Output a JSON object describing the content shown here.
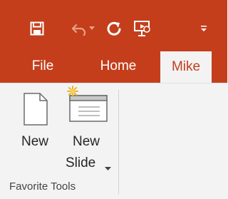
{
  "quick_access": {
    "save_icon": "save-icon",
    "undo_icon": "undo-icon",
    "redo_icon": "repeat-icon",
    "present_icon": "present-from-beginning-icon",
    "customize_icon": "customize-qat-icon"
  },
  "tabs": [
    {
      "label": "File",
      "active": false
    },
    {
      "label": "Home",
      "active": false
    },
    {
      "label": "Mike",
      "active": true
    }
  ],
  "ribbon": {
    "buttons": [
      {
        "label": "New",
        "icon": "blank-document-icon"
      },
      {
        "label_line1": "New",
        "label_line2": "Slide",
        "icon": "new-slide-icon",
        "has_dropdown": true
      }
    ],
    "group_label": "Favorite Tools"
  },
  "colors": {
    "accent": "#c43e1c",
    "ribbon_bg": "#f3f3f3"
  }
}
